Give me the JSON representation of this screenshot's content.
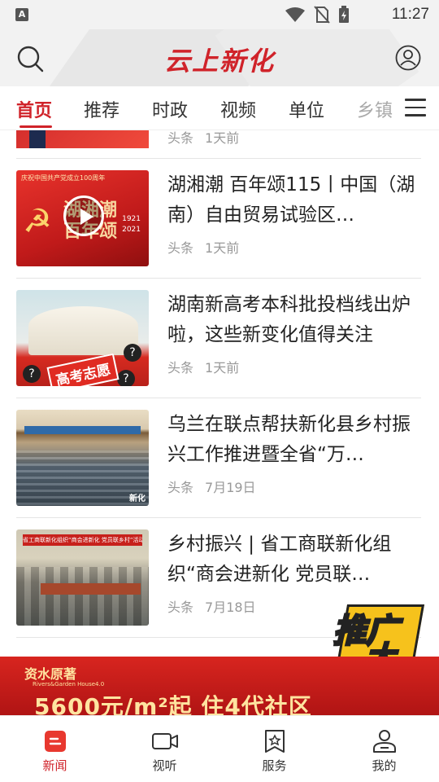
{
  "status_bar": {
    "time": "11:27",
    "left_icon": "A"
  },
  "header": {
    "logo": "云上新化"
  },
  "tabs": [
    {
      "label": "首页",
      "active": true
    },
    {
      "label": "推荐"
    },
    {
      "label": "时政"
    },
    {
      "label": "视频"
    },
    {
      "label": "单位"
    },
    {
      "label": "乡镇"
    }
  ],
  "partial_item": {
    "source": "头条",
    "time": "1天前"
  },
  "news": [
    {
      "title": "湖湘潮 百年颂115丨中国（湖南）自由贸易试验区…",
      "source": "头条",
      "time": "1天前",
      "thumb": {
        "banner": "庆祝中国共产党成立100周年",
        "line1": "湖湘潮",
        "line2": "百年颂",
        "years_top": "1921",
        "years_bottom": "2021"
      }
    },
    {
      "title": "湖南新高考本科批投档线出炉啦，这些新变化值得关注",
      "source": "头条",
      "time": "1天前",
      "thumb": {
        "ribbon": "高考志愿"
      }
    },
    {
      "title": "乌兰在联点帮扶新化县乡村振兴工作推进暨全省“万…",
      "source": "头条",
      "time": "7月19日",
      "thumb": {
        "watermark": "新化"
      }
    },
    {
      "title": "乡村振兴 | 省工商联新化组织“商会进新化 党员联…",
      "source": "头条",
      "time": "7月18日",
      "thumb": {
        "banner": "省工商联新化组织“商会进新化 党员联乡村”活动对接会"
      }
    }
  ],
  "ambassador": {
    "line1": "推广",
    "line2": "大使"
  },
  "ad": {
    "brand": "资水原著",
    "brand_sub": "Rivers&Garden House4.0",
    "headline": "5600元/m²起 住4代社区"
  },
  "bottom_nav": [
    {
      "label": "新闻",
      "icon": "news-icon",
      "active": true
    },
    {
      "label": "视听",
      "icon": "video-camera-icon"
    },
    {
      "label": "服务",
      "icon": "service-bookmark-icon"
    },
    {
      "label": "我的",
      "icon": "profile-icon"
    }
  ],
  "colors": {
    "accent": "#d0232a",
    "meta_gray": "#999999",
    "divider": "#e5e5e5"
  }
}
